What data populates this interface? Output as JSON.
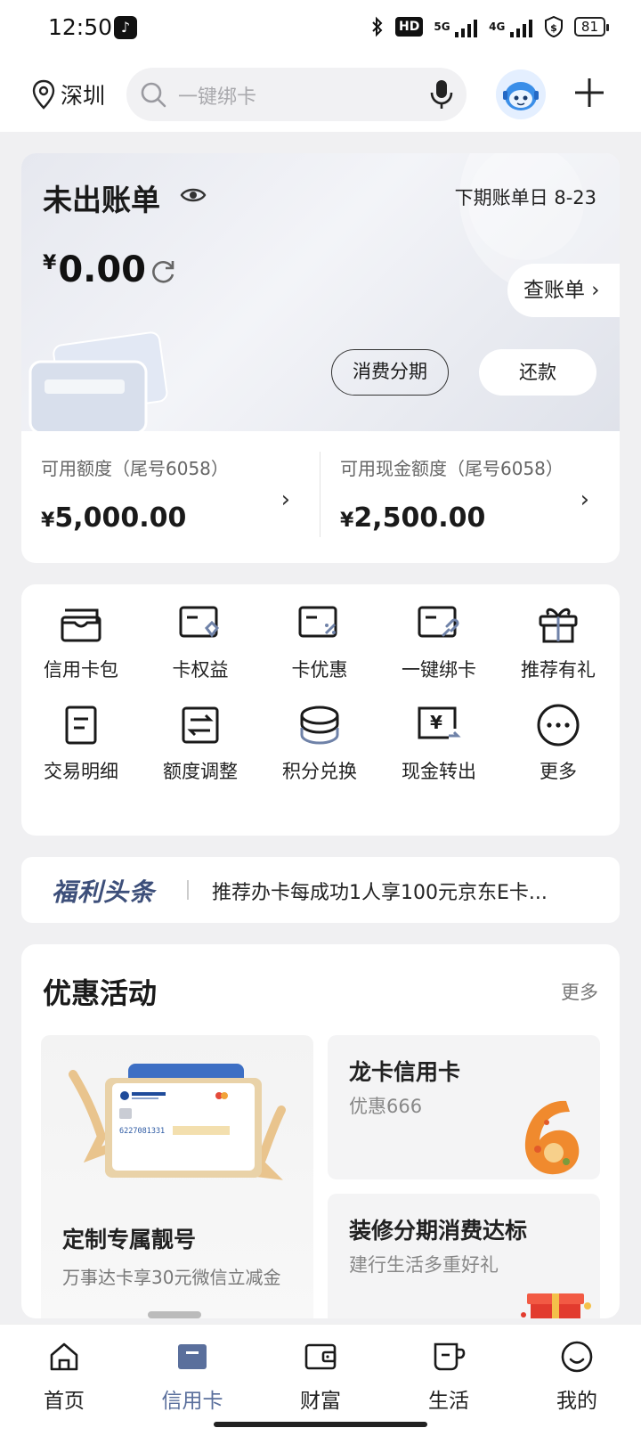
{
  "status_bar": {
    "time": "12:50",
    "signal_1": "5G",
    "signal_2": "4G",
    "hd": "HD",
    "battery": "81"
  },
  "header": {
    "location": "深圳",
    "search_placeholder": "一键绑卡"
  },
  "bill": {
    "title": "未出账单",
    "next_bill_label": "下期账单日  8-23",
    "currency": "¥",
    "amount": "0.00",
    "check_bill": "查账单 ›",
    "installment_button": "消费分期",
    "repay_button": "还款",
    "credit_limit_label": "可用额度（尾号6058）",
    "credit_limit_value": "5,000.00",
    "cash_limit_label": "可用现金额度（尾号6058）",
    "cash_limit_value": "2,500.00"
  },
  "services": [
    {
      "label": "信用卡包",
      "icon": "card-wallet-icon"
    },
    {
      "label": "卡权益",
      "icon": "card-benefit-icon"
    },
    {
      "label": "卡优惠",
      "icon": "card-discount-icon"
    },
    {
      "label": "一键绑卡",
      "icon": "card-bind-icon"
    },
    {
      "label": "推荐有礼",
      "icon": "gift-icon"
    },
    {
      "label": "交易明细",
      "icon": "transaction-detail-icon"
    },
    {
      "label": "额度调整",
      "icon": "limit-adjust-icon"
    },
    {
      "label": "积分兑换",
      "icon": "points-coins-icon"
    },
    {
      "label": "现金转出",
      "icon": "cash-transfer-icon"
    },
    {
      "label": "更多",
      "icon": "more-dots-icon"
    }
  ],
  "news": {
    "tag": "福利头条",
    "text": "推荐办卡每成功1人享100元京东E卡..."
  },
  "promotions": {
    "title": "优惠活动",
    "more": "更多",
    "cards": [
      {
        "title": "定制专属靓号",
        "subtitle": "万事达卡享30元微信立减金"
      },
      {
        "title": "龙卡信用卡",
        "subtitle": "优惠666"
      },
      {
        "title": "装修分期消费达标",
        "subtitle": "建行生活多重好礼"
      }
    ],
    "card_number": "6227081331"
  },
  "tabbar": [
    {
      "label": "首页",
      "icon": "home-icon"
    },
    {
      "label": "信用卡",
      "icon": "credit-card-icon"
    },
    {
      "label": "财富",
      "icon": "wallet-icon"
    },
    {
      "label": "生活",
      "icon": "cup-icon"
    },
    {
      "label": "我的",
      "icon": "smile-icon"
    }
  ],
  "colors": {
    "accent": "#5a6f9c",
    "news_tag": "#3d4f7a",
    "background": "#f0f0f2"
  }
}
